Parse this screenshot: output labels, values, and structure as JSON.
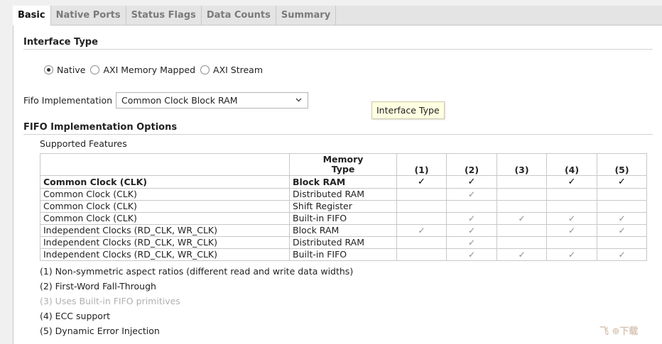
{
  "tabs": [
    "Basic",
    "Native Ports",
    "Status Flags",
    "Data Counts",
    "Summary"
  ],
  "interface_type": {
    "title": "Interface Type",
    "options": [
      {
        "label": "Native",
        "checked": true
      },
      {
        "label": "AXI Memory Mapped",
        "checked": false
      },
      {
        "label": "AXI Stream",
        "checked": false
      }
    ]
  },
  "fifo_impl": {
    "label": "Fifo Implementation",
    "value": "Common Clock Block RAM"
  },
  "tooltip": "Interface Type",
  "options_section": {
    "title": "FIFO Implementation Options",
    "supported_label": "Supported Features",
    "memory_type_header": [
      "Memory",
      "Type"
    ],
    "col_headers": [
      "(1)",
      "(2)",
      "(3)",
      "(4)",
      "(5)"
    ],
    "rows": [
      {
        "clock": "Common Clock (CLK)",
        "memory": "Block RAM",
        "bold": true,
        "checks": [
          true,
          true,
          false,
          true,
          true
        ]
      },
      {
        "clock": "Common Clock (CLK)",
        "memory": "Distributed RAM",
        "bold": false,
        "checks": [
          false,
          true,
          false,
          false,
          false
        ]
      },
      {
        "clock": "Common Clock (CLK)",
        "memory": "Shift Register",
        "bold": false,
        "checks": [
          false,
          false,
          false,
          false,
          false
        ]
      },
      {
        "clock": "Common Clock (CLK)",
        "memory": "Built-in FIFO",
        "bold": false,
        "checks": [
          false,
          true,
          true,
          true,
          true
        ]
      },
      {
        "clock": "Independent Clocks (RD_CLK, WR_CLK)",
        "memory": "Block RAM",
        "bold": false,
        "checks": [
          true,
          true,
          false,
          true,
          true
        ]
      },
      {
        "clock": "Independent Clocks (RD_CLK, WR_CLK)",
        "memory": "Distributed RAM",
        "bold": false,
        "checks": [
          false,
          true,
          false,
          false,
          false
        ]
      },
      {
        "clock": "Independent Clocks (RD_CLK, WR_CLK)",
        "memory": "Built-in FIFO",
        "bold": false,
        "checks": [
          false,
          true,
          true,
          true,
          true
        ]
      }
    ],
    "check_glyph": "✓",
    "notes": [
      {
        "text": "(1) Non-symmetric aspect ratios (different read and write data widths)",
        "dim": false
      },
      {
        "text": "(2) First-Word Fall-Through",
        "dim": false
      },
      {
        "text": "(3) Uses Built-in FIFO primitives",
        "dim": true
      },
      {
        "text": "(4) ECC support",
        "dim": false
      },
      {
        "text": "(5) Dynamic Error Injection",
        "dim": false
      }
    ]
  },
  "watermark": "飞 ⊕下载",
  "colors": {
    "tab_bar": "#e4e4e4",
    "tooltip_bg": "#ffffe1",
    "border": "#c8c8c8",
    "dim_text": "#b0b0b0"
  }
}
